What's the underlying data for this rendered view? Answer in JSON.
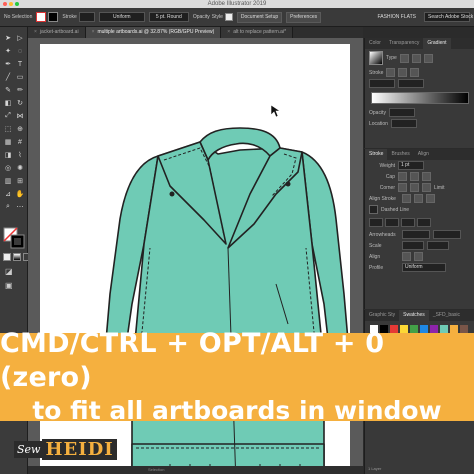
{
  "window": {
    "title": "Adobe Illustrator 2019",
    "workspace": "FASHION FLATS",
    "search_placeholder": "Search Adobe Stock"
  },
  "control_bar": {
    "selection_label": "No Selection",
    "stroke_label": "Stroke",
    "stroke_profile": "Uniform",
    "brush": "5 pt. Round",
    "opacity_label": "Opacity",
    "style_label": "Style",
    "document_setup": "Document Setup",
    "preferences": "Preferences"
  },
  "tabs": [
    {
      "label": "jacket-artboard.ai",
      "active": false
    },
    {
      "label": "multiple artboards.ai @ 32.87% (RGB/GPU Preview)",
      "active": true
    },
    {
      "label": "alt to replace pattern.ai*",
      "active": false
    }
  ],
  "gradient_panel": {
    "tabs": [
      "Color",
      "Transparency",
      "Gradient"
    ],
    "type_label": "Type",
    "stroke_label": "Stroke",
    "angle_label": "Opacity",
    "location_label": "Location"
  },
  "stroke_panel": {
    "tabs": [
      "Stroke",
      "Brushes",
      "Align"
    ],
    "weight_label": "Weight",
    "weight_value": "1 pt",
    "cap_label": "Cap",
    "corner_label": "Corner",
    "limit_label": "Limit",
    "align_label": "Align Stroke",
    "dashed_label": "Dashed Line",
    "arrowheads_label": "Arrowheads",
    "scale_label": "Scale",
    "align_arrows_label": "Align",
    "profile_label": "Profile",
    "profile_value": "Uniform"
  },
  "swatches_panel": {
    "tabs": [
      "Graphic Sty",
      "Swatches",
      "_SFD_basic"
    ]
  },
  "status": {
    "tool": "Selection",
    "layers": "1 Layer"
  },
  "banner": {
    "line1": "CMD/CTRL + OPT/ALT + 0 (zero)",
    "line2": "to fit all artboards in window"
  },
  "logo": {
    "sew": "Sew",
    "heidi": "HEIDI"
  },
  "colors": {
    "banner": "#f5b03f",
    "jacket_fill": "#6fcbb5",
    "ui_dark": "#2b2b2b"
  }
}
